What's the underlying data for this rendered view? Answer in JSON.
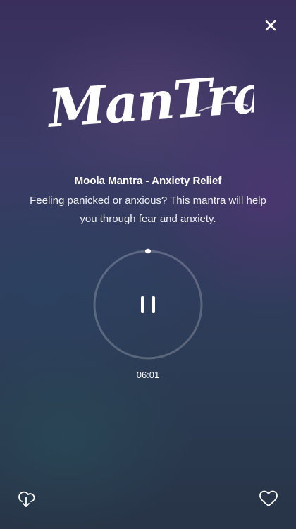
{
  "header": {
    "close_icon": "close-icon",
    "logo_text": "ManTras"
  },
  "track": {
    "title": "Moola Mantra - Anxiety Relief",
    "description": "Feeling panicked or anxious? This mantra will help you through fear and anxiety.",
    "elapsed": "06:01",
    "state": "playing",
    "control_icon": "pause-icon"
  },
  "footer": {
    "download_icon": "download-icon",
    "favorite_icon": "heart-icon"
  },
  "colors": {
    "text": "#ffffff",
    "progress_track": "rgba(255,255,255,0.25)",
    "progress_knob": "#ffffff"
  }
}
